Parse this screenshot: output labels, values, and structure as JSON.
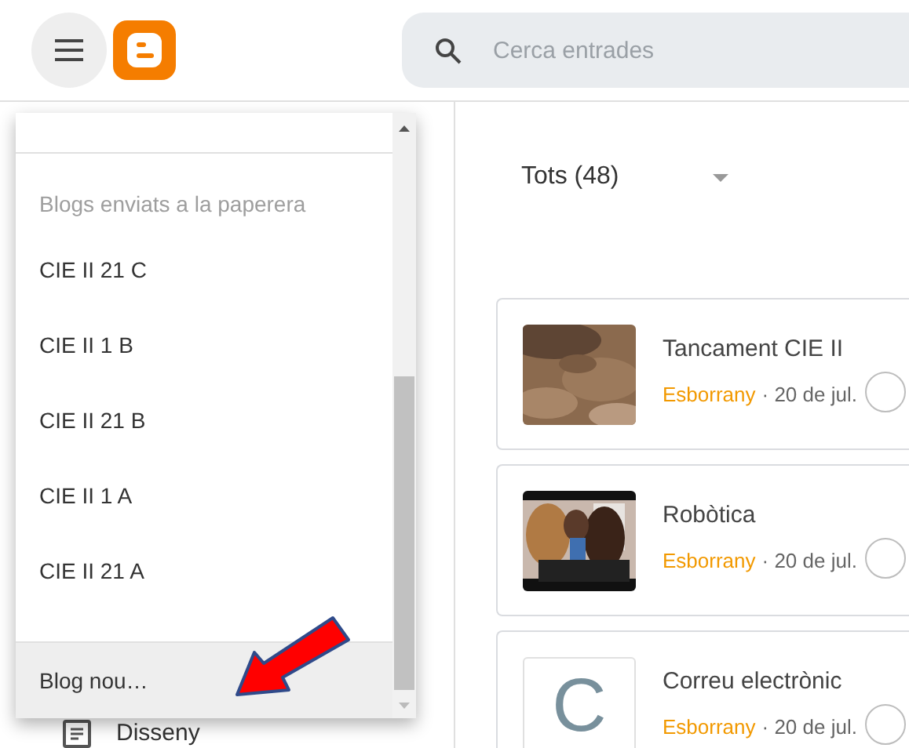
{
  "header": {
    "search": {
      "placeholder": "Cerca entrades"
    }
  },
  "blog_menu": {
    "section_label": "Blogs enviats a la paperera",
    "blogs": [
      {
        "label": "CIE II 21 C"
      },
      {
        "label": "CIE II 1 B"
      },
      {
        "label": "CIE II 21 B"
      },
      {
        "label": "CIE II 1 A"
      },
      {
        "label": "CIE II 21 A"
      }
    ],
    "new_blog": {
      "label": "Blog nou…",
      "selected": true
    }
  },
  "sidebar": {
    "items": [
      {
        "label": "Disseny"
      }
    ]
  },
  "filter": {
    "label": "Tots (48)"
  },
  "posts": [
    {
      "title": "Tancament CIE II",
      "status": "Esborrany",
      "date": "· 20 de jul."
    },
    {
      "title": "Robòtica",
      "status": "Esborrany",
      "date": "· 20 de jul."
    },
    {
      "title": "Correu electrònic",
      "status": "Esborrany",
      "date": "· 20 de jul.",
      "thumbnail": {
        "kind": "letter",
        "letter": "C"
      }
    }
  ]
}
